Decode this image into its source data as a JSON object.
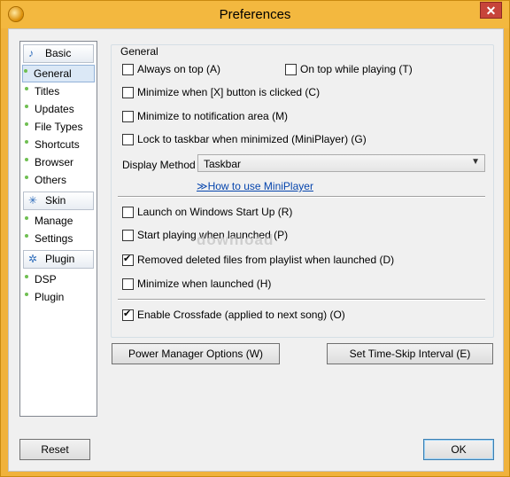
{
  "window": {
    "title": "Preferences",
    "close_glyph": "✕"
  },
  "nav": {
    "groups": [
      {
        "label": "Basic",
        "icon": "music-note-icon",
        "glyph": "♪"
      },
      {
        "label": "Skin",
        "icon": "sparkle-icon",
        "glyph": "✳"
      },
      {
        "label": "Plugin",
        "icon": "gear-icon",
        "glyph": "✲"
      }
    ],
    "basic_items": [
      "General",
      "Titles",
      "Updates",
      "File Types",
      "Shortcuts",
      "Browser",
      "Others"
    ],
    "skin_items": [
      "Manage",
      "Settings"
    ],
    "plugin_items": [
      "DSP",
      "Plugin"
    ],
    "selected": "General"
  },
  "general": {
    "legend": "General",
    "always_on_top": {
      "label": "Always on top (A)",
      "checked": false
    },
    "on_top_while_playing": {
      "label": "On top while playing (T)",
      "checked": false
    },
    "minimize_on_x": {
      "label": "Minimize when [X] button is clicked (C)",
      "checked": false
    },
    "minimize_to_tray": {
      "label": "Minimize to notification area (M)",
      "checked": false
    },
    "lock_to_taskbar": {
      "label": "Lock to taskbar when minimized (MiniPlayer) (G)",
      "checked": false
    },
    "display_method_label": "Display Method",
    "display_method_value": "Taskbar",
    "how_to_link": "≫How to use MiniPlayer",
    "launch_on_startup": {
      "label": "Launch on Windows Start Up (R)",
      "checked": false
    },
    "start_playing": {
      "label": "Start playing when launched (P)",
      "checked": false
    },
    "removed_deleted": {
      "label": "Removed deleted files from playlist when launched (D)",
      "checked": true
    },
    "minimize_when_launched": {
      "label": "Minimize when launched (H)",
      "checked": false
    },
    "enable_crossfade": {
      "label": "Enable Crossfade (applied to next song) (O)",
      "checked": true
    }
  },
  "buttons": {
    "power_manager": "Power Manager Options (W)",
    "time_skip": "Set Time-Skip Interval (E)",
    "reset": "Reset",
    "ok": "OK"
  },
  "watermark": "download"
}
